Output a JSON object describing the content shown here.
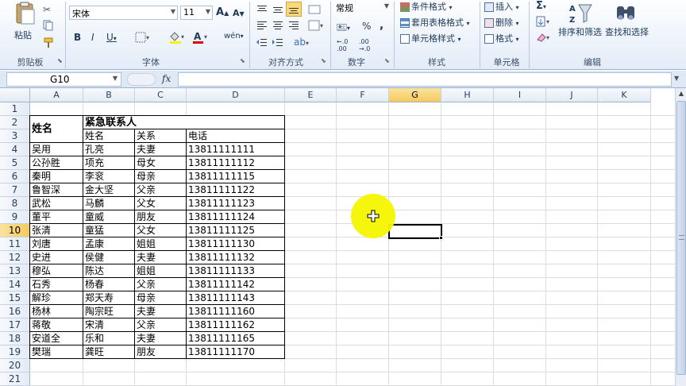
{
  "ribbon": {
    "clipboard": {
      "paste_label": "粘贴",
      "group_label": "剪贴板"
    },
    "font": {
      "font_name": "宋体",
      "font_size": "11",
      "group_label": "字体"
    },
    "alignment": {
      "group_label": "对齐方式"
    },
    "number": {
      "format": "常规",
      "group_label": "数字"
    },
    "styles": {
      "conditional": "条件格式",
      "table": "套用表格格式",
      "cell": "单元格样式",
      "group_label": "样式"
    },
    "cells": {
      "insert": "插入",
      "delete": "删除",
      "format": "格式",
      "group_label": "单元格"
    },
    "editing": {
      "sort_filter": "排序和筛选",
      "find_select": "查找和选择",
      "group_label": "编辑"
    }
  },
  "formula_bar": {
    "name_box": "G10",
    "fx": "fx",
    "content": ""
  },
  "columns": [
    "A",
    "B",
    "C",
    "D",
    "E",
    "F",
    "G",
    "H",
    "I",
    "J",
    "K"
  ],
  "rows": [
    "1",
    "2",
    "3",
    "4",
    "5",
    "6",
    "7",
    "8",
    "9",
    "10",
    "11",
    "12",
    "13",
    "14",
    "15",
    "16",
    "17",
    "18",
    "19",
    "20",
    "21"
  ],
  "selected_cell": {
    "column": "G",
    "row": "10"
  },
  "sheet": {
    "header_name": "姓名",
    "header_group": "紧急联系人",
    "sub_headers": [
      "姓名",
      "关系",
      "电话"
    ],
    "records": [
      {
        "name": "吴用",
        "contact": "孔亮",
        "relation": "夫妻",
        "phone": "13811111111"
      },
      {
        "name": "公孙胜",
        "contact": "项充",
        "relation": "母女",
        "phone": "13811111112"
      },
      {
        "name": "秦明",
        "contact": "李衮",
        "relation": "母亲",
        "phone": "13811111115"
      },
      {
        "name": "鲁智深",
        "contact": "金大坚",
        "relation": "父亲",
        "phone": "13811111122"
      },
      {
        "name": "武松",
        "contact": "马麟",
        "relation": "父女",
        "phone": "13811111123"
      },
      {
        "name": "董平",
        "contact": "童威",
        "relation": "朋友",
        "phone": "13811111124"
      },
      {
        "name": "张清",
        "contact": "童猛",
        "relation": "父女",
        "phone": "13811111125"
      },
      {
        "name": "刘唐",
        "contact": "孟康",
        "relation": "姐姐",
        "phone": "13811111130"
      },
      {
        "name": "史进",
        "contact": "侯健",
        "relation": "夫妻",
        "phone": "13811111132"
      },
      {
        "name": "穆弘",
        "contact": "陈达",
        "relation": "姐姐",
        "phone": "13811111133"
      },
      {
        "name": "石秀",
        "contact": "杨春",
        "relation": "父亲",
        "phone": "13811111142"
      },
      {
        "name": "解珍",
        "contact": "郑天寿",
        "relation": "母亲",
        "phone": "13811111143"
      },
      {
        "name": "杨林",
        "contact": "陶宗旺",
        "relation": "夫妻",
        "phone": "13811111160"
      },
      {
        "name": "蒋敬",
        "contact": "宋清",
        "relation": "父亲",
        "phone": "13811111162"
      },
      {
        "name": "安道全",
        "contact": "乐和",
        "relation": "夫妻",
        "phone": "13811111165"
      },
      {
        "name": "樊瑞",
        "contact": "龚旺",
        "relation": "朋友",
        "phone": "13811111170"
      }
    ]
  },
  "colors": {
    "accent": "#f6c95d",
    "highlight": "#f5f500",
    "header_bg": "#e4ebf5"
  }
}
